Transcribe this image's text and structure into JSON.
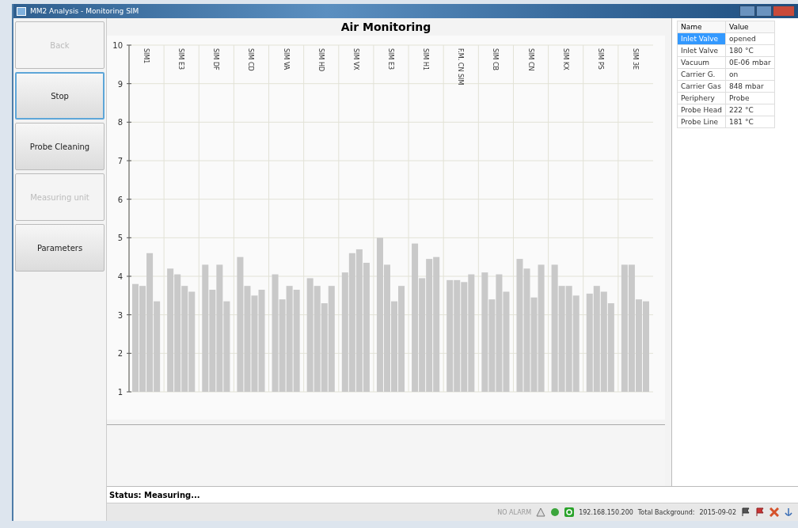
{
  "window": {
    "title": "MM2 Analysis - Monitoring SIM"
  },
  "sidebar": {
    "buttons": [
      {
        "label": "Back",
        "disabled": true,
        "selected": false
      },
      {
        "label": "Stop",
        "disabled": false,
        "selected": true
      },
      {
        "label": "Probe Cleaning",
        "disabled": false,
        "selected": false
      },
      {
        "label": "Measuring unit",
        "disabled": true,
        "selected": false
      },
      {
        "label": "Parameters",
        "disabled": false,
        "selected": false
      }
    ]
  },
  "chart": {
    "title": "Air Monitoring",
    "chart_data": {
      "type": "bar",
      "grid": true,
      "ylim": [
        1,
        10
      ],
      "yticks": [
        1,
        2,
        3,
        4,
        5,
        6,
        7,
        8,
        9,
        10
      ],
      "categories": [
        "SIM1",
        "SIM E3",
        "SIM DF",
        "SIM CD",
        "SIM VA",
        "SIM HD",
        "SIM VX",
        "SIM E3",
        "SIM H1",
        "F.M. CN SIM",
        "SIM CB",
        "SIM CN",
        "SIM KX",
        "SIM PS",
        "SIM 3E"
      ],
      "series": [
        {
          "color": "#c9c9c9",
          "values": [
            3.8,
            4.2,
            4.3,
            4.5,
            4.05,
            3.95,
            4.1,
            5.0,
            4.85,
            3.9,
            4.1,
            4.45,
            4.3,
            3.55,
            4.3
          ]
        },
        {
          "color": "#c9c9c9",
          "values": [
            3.75,
            4.05,
            3.65,
            3.75,
            3.4,
            3.75,
            4.6,
            4.3,
            3.95,
            3.9,
            3.4,
            4.2,
            3.75,
            3.75,
            4.3
          ]
        },
        {
          "color": "#c9c9c9",
          "values": [
            4.6,
            3.75,
            4.3,
            3.5,
            3.75,
            3.3,
            4.7,
            3.35,
            4.45,
            3.85,
            4.05,
            3.45,
            3.75,
            3.6,
            3.4
          ]
        },
        {
          "color": "#c9c9c9",
          "values": [
            3.35,
            3.6,
            3.35,
            3.65,
            3.65,
            3.75,
            4.35,
            3.75,
            4.5,
            4.05,
            3.6,
            4.3,
            3.5,
            3.3,
            3.35
          ]
        }
      ]
    }
  },
  "properties": {
    "columns": [
      "Name",
      "Value"
    ],
    "rows": [
      {
        "name": "Inlet Valve",
        "value": "opened",
        "selected": true
      },
      {
        "name": "Inlet Valve",
        "value": "180 °C",
        "selected": false
      },
      {
        "name": "Vacuum",
        "value": "0E-06 mbar",
        "selected": false
      },
      {
        "name": "Carrier G.",
        "value": "on",
        "selected": false
      },
      {
        "name": "Carrier Gas",
        "value": "848 mbar",
        "selected": false
      },
      {
        "name": "Periphery",
        "value": "Probe",
        "selected": false
      },
      {
        "name": "Probe Head",
        "value": "222 °C",
        "selected": false
      },
      {
        "name": "Probe Line",
        "value": "181 °C",
        "selected": false
      }
    ]
  },
  "status": {
    "text": "Status: Measuring..."
  },
  "bottom_bar": {
    "alarm": "NO ALARM",
    "ip": "192.168.150.200",
    "background_label": "Total Background:",
    "date": "2015-09-02"
  }
}
